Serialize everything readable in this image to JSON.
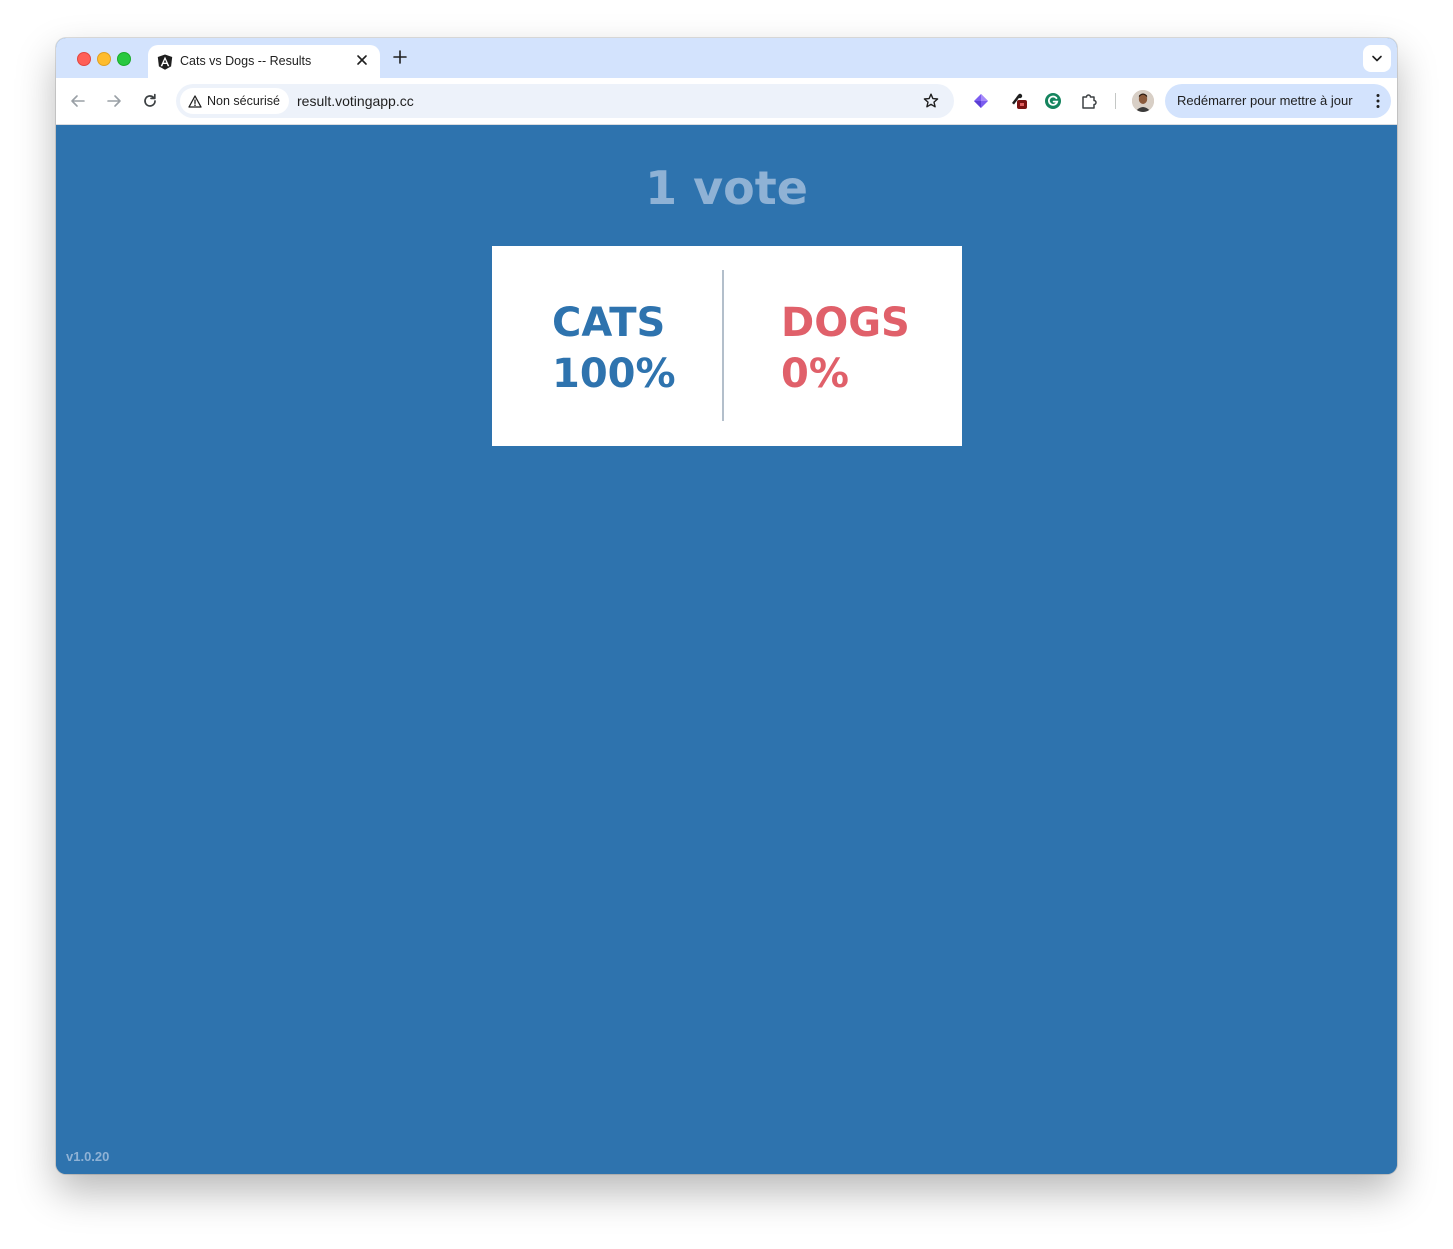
{
  "browser": {
    "tab": {
      "title": "Cats vs Dogs -- Results"
    },
    "security_label": "Non sécurisé",
    "url": "result.votingapp.cc",
    "relaunch_label": "Redémarrer pour mettre à jour",
    "icons": [
      "angular-logo-icon",
      "close-icon",
      "plus-icon",
      "chevron-down-icon",
      "back-arrow-icon",
      "forward-arrow-icon",
      "reload-icon",
      "warning-icon",
      "star-icon",
      "extension-icons",
      "puzzle-icon",
      "avatar",
      "more-vert-icon"
    ]
  },
  "page": {
    "vote_count": "1 vote",
    "choices": [
      {
        "name": "CATS",
        "percent": "100%",
        "color": "#2e73ae"
      },
      {
        "name": "DOGS",
        "percent": "0%",
        "color": "#e0606a"
      }
    ],
    "version": "v1.0.20",
    "background_color": "#2e73ae"
  }
}
